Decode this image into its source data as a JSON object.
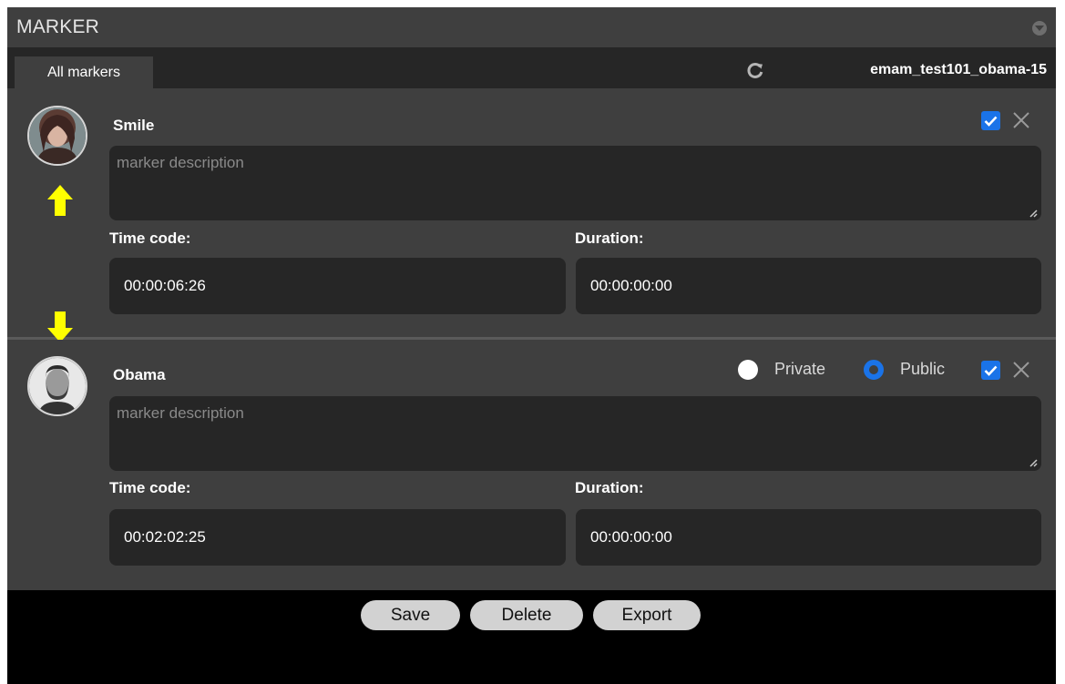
{
  "header": {
    "title": "MARKER",
    "collapse_icon": "chevron-down-circle-icon"
  },
  "tabs": {
    "active_label": "All markers",
    "refresh_icon": "refresh-icon",
    "asset_name": "emam_test101_obama-15"
  },
  "markers": [
    {
      "name": "Smile",
      "description_placeholder": "marker description",
      "time_code_label": "Time code:",
      "time_code": "00:00:06:26",
      "duration_label": "Duration:",
      "duration": "00:00:00:00",
      "checked": true,
      "avatar_icon": "woman-face-avatar",
      "arrow_icon": "up-arrow-icon"
    },
    {
      "name": "Obama",
      "description_placeholder": "marker description",
      "time_code_label": "Time code:",
      "time_code": "00:02:02:25",
      "duration_label": "Duration:",
      "duration": "00:00:00:00",
      "checked": true,
      "avatar_icon": "man-face-avatar",
      "arrow_icon": "down-arrow-icon",
      "visibility": {
        "private_label": "Private",
        "public_label": "Public",
        "selected": "Public"
      }
    }
  ],
  "footer": {
    "save_label": "Save",
    "delete_label": "Delete",
    "export_label": "Export"
  },
  "colors": {
    "accent": "#1a73e8",
    "arrow": "#ffff00",
    "panel_bg": "#3f3f3f",
    "field_bg": "#262626"
  }
}
